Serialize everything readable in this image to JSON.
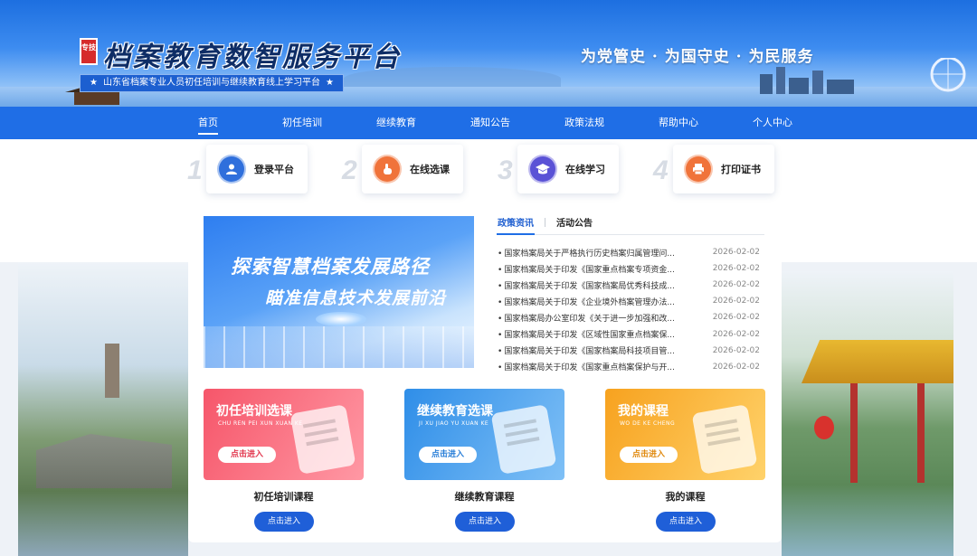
{
  "header": {
    "logo_badge": "专技",
    "site_title": "档案教育数智服务平台",
    "subtitle": "山东省档案专业人员初任培训与继续教育线上学习平台",
    "slogan": "为党管史 · 为国守史 · 为民服务"
  },
  "nav": {
    "items": [
      {
        "label": "首页"
      },
      {
        "label": "初任培训"
      },
      {
        "label": "继续教育"
      },
      {
        "label": "通知公告"
      },
      {
        "label": "政策法规"
      },
      {
        "label": "帮助中心"
      },
      {
        "label": "个人中心"
      }
    ],
    "active": "首页"
  },
  "steps": [
    {
      "num": "1",
      "label": "登录平台",
      "icon": "user-icon",
      "color": "#2f6fdc"
    },
    {
      "num": "2",
      "label": "在线选课",
      "icon": "pointer-hand-icon",
      "color": "#f0733a"
    },
    {
      "num": "3",
      "label": "在线学习",
      "icon": "graduation-cap-icon",
      "color": "#5a52d6"
    },
    {
      "num": "4",
      "label": "打印证书",
      "icon": "printer-icon",
      "color": "#f0733a"
    }
  ],
  "hero": {
    "line1": "探索智慧档案发展路径",
    "line2": "瞄准信息技术发展前沿"
  },
  "news": {
    "tabs": [
      "政策资讯",
      "活动公告"
    ],
    "active_tab": "政策资讯",
    "items": [
      {
        "title": "国家档案局关于严格执行历史档案归属管理问...",
        "date": "2026-02-02"
      },
      {
        "title": "国家档案局关于印发《国家重点档案专项资金...",
        "date": "2026-02-02"
      },
      {
        "title": "国家档案局关于印发《国家档案局优秀科技成...",
        "date": "2026-02-02"
      },
      {
        "title": "国家档案局关于印发《企业境外档案管理办法...",
        "date": "2026-02-02"
      },
      {
        "title": "国家档案局办公室印发《关于进一步加强和改...",
        "date": "2026-02-02"
      },
      {
        "title": "国家档案局关于印发《区域性国家重点档案保...",
        "date": "2026-02-02"
      },
      {
        "title": "国家档案局关于印发《国家档案局科技项目管...",
        "date": "2026-02-02"
      },
      {
        "title": "国家档案局关于印发《国家重点档案保护与开...",
        "date": "2026-02-02"
      }
    ]
  },
  "courses": [
    {
      "card_title": "初任培训选课",
      "pinyin": "CHU REN PEI XUN XUAN KE",
      "card_button": "点击进入",
      "name": "初任培训课程",
      "enter": "点击进入",
      "color_a": "#f6566a",
      "color_b": "#ff98a4",
      "btn_color": "#e2384f"
    },
    {
      "card_title": "继续教育选课",
      "pinyin": "JI XU JIAO YU XUAN KE",
      "card_button": "点击进入",
      "name": "继续教育课程",
      "enter": "点击进入",
      "color_a": "#2f8ee8",
      "color_b": "#7fc0f6",
      "btn_color": "#2a7fd8"
    },
    {
      "card_title": "我的课程",
      "pinyin": "WO DE KE CHENG",
      "card_button": "点击进入",
      "name": "我的课程",
      "enter": "点击进入",
      "color_a": "#f7a21f",
      "color_b": "#ffd26a",
      "btn_color": "#e08a10"
    }
  ]
}
